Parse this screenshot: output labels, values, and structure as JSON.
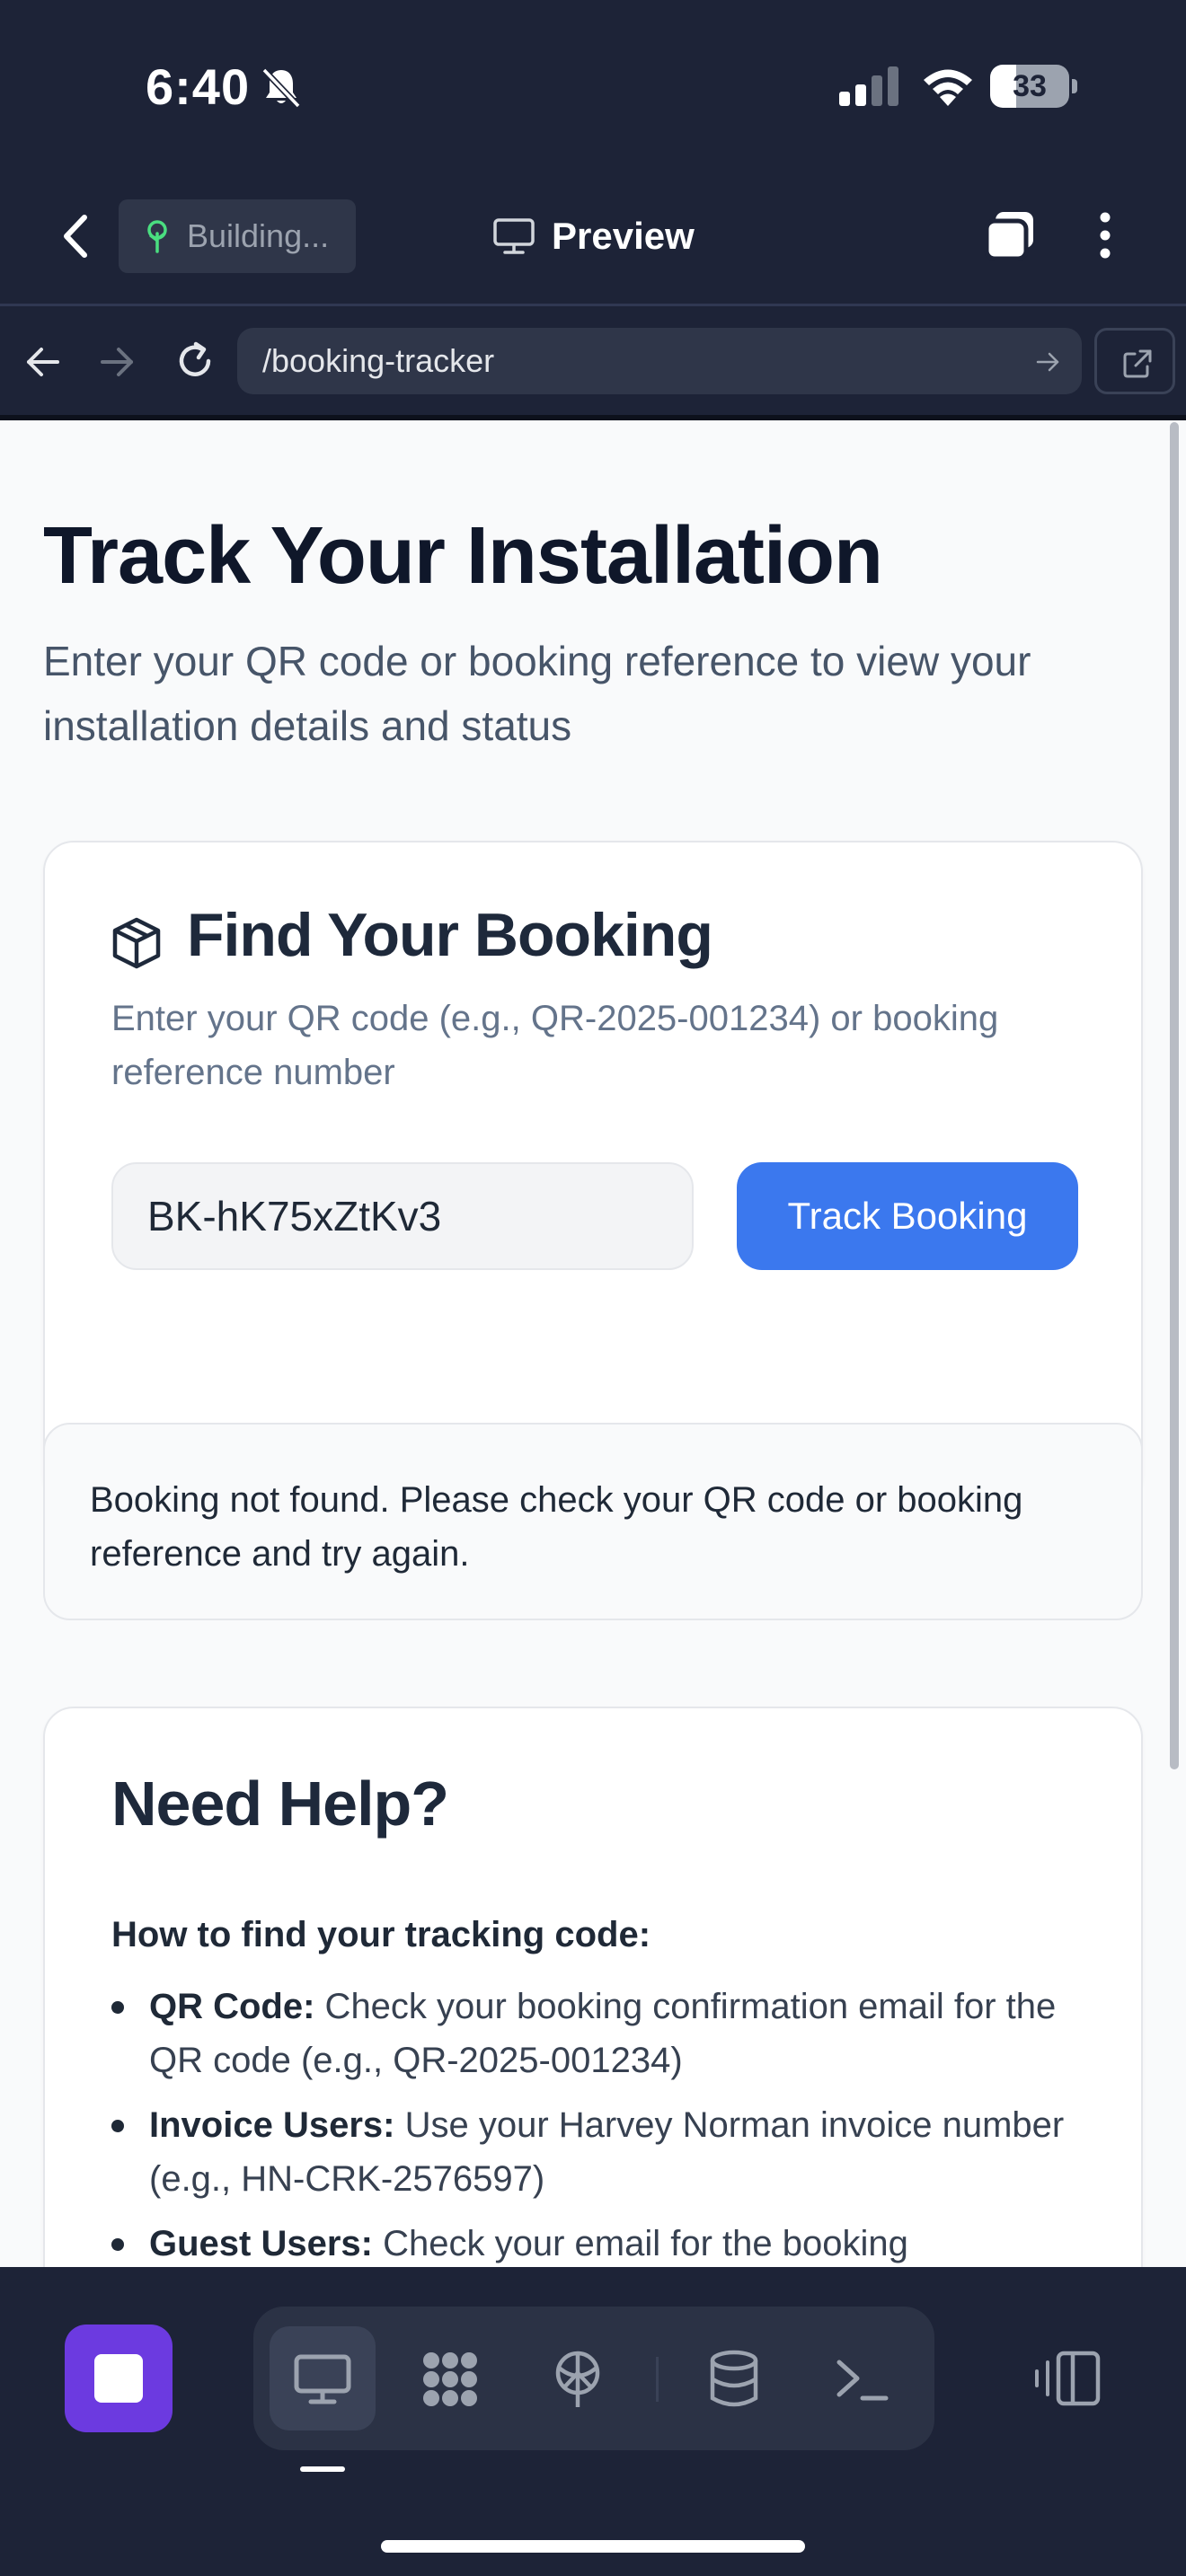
{
  "status_bar": {
    "time": "6:40",
    "battery": "33",
    "battery_level": 0.33
  },
  "app_header": {
    "build_status": "Building...",
    "preview_label": "Preview"
  },
  "browser": {
    "url": "/booking-tracker"
  },
  "page": {
    "title": "Track Your Installation",
    "subtitle": "Enter your QR code or booking reference to view your installation details and status"
  },
  "find_card": {
    "title": "Find Your Booking",
    "description": "Enter your QR code (e.g., QR-2025-001234) or booking reference number",
    "input_value": "BK-hK75xZtKv3",
    "button_label": "Track Booking"
  },
  "alert": {
    "message": "Booking not found. Please check your QR code or booking reference and try again."
  },
  "help": {
    "title": "Need Help?",
    "subtitle": "How to find your tracking code:",
    "items": [
      {
        "label": "QR Code:",
        "text": " Check your booking confirmation email for the QR code (e.g., QR-2025-001234)"
      },
      {
        "label": "Invoice Users:",
        "text": " Use your Harvey Norman invoice number (e.g., HN-CRK-2576597)"
      },
      {
        "label": "Guest Users:",
        "text": " Check your email for the booking"
      }
    ]
  },
  "toolbar": {
    "tools": [
      "monitor-icon",
      "modules-icon",
      "deploy-icon",
      "database-icon",
      "terminal-icon"
    ],
    "active_tool": "monitor-icon"
  },
  "colors": {
    "chrome_bg": "#1d2337",
    "accent_blue": "#3b78ee",
    "stop_purple": "#6c3ae0",
    "page_bg": "#f9fafb"
  }
}
